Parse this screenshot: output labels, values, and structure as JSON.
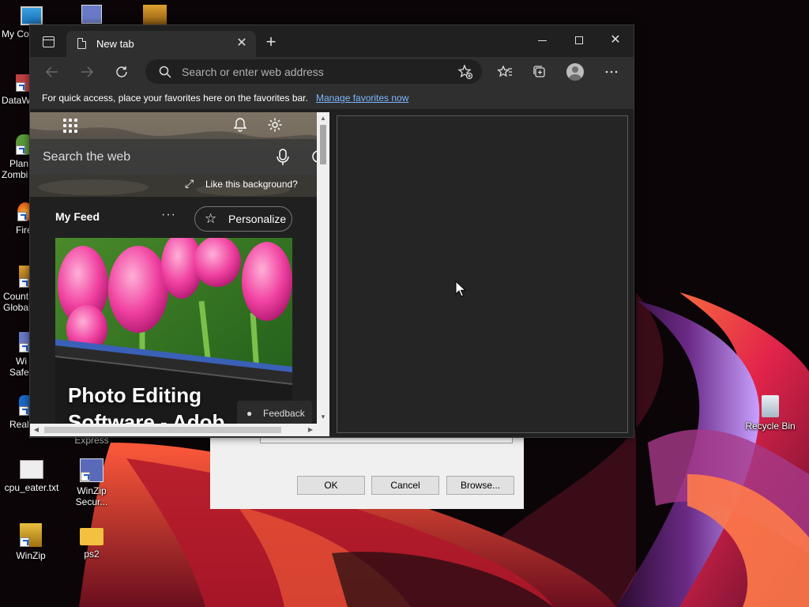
{
  "desktop": {
    "icons": [
      {
        "label": "My Co",
        "name": "my-computer"
      },
      {
        "label": "DataW",
        "name": "dataw"
      },
      {
        "label": "Plan",
        "label2": "Zombi",
        "name": "plants-vs-zombies"
      },
      {
        "label": "Fire",
        "name": "firefox"
      },
      {
        "label": "Count",
        "label2": "Global",
        "name": "counter-strike"
      },
      {
        "label": "Wi",
        "label2": "Safe",
        "name": "winzip-safe"
      },
      {
        "label": "Reall",
        "name": "realplayer"
      },
      {
        "label": "cpu_eater.txt",
        "name": "cpu-eater"
      },
      {
        "label": "WinZip",
        "label2": "Secur...",
        "name": "winzip-secure"
      },
      {
        "label": "WinZip",
        "name": "winzip"
      },
      {
        "label": "ps2",
        "name": "ps2"
      },
      {
        "label": "Express",
        "name": "express"
      },
      {
        "label": "Recycle Bin",
        "name": "recycle-bin"
      }
    ]
  },
  "dialog": {
    "ok_label": "OK",
    "cancel_label": "Cancel",
    "browse_label": "Browse..."
  },
  "browser": {
    "tab": {
      "title": "New tab",
      "close": "✕"
    },
    "new_tab": "+",
    "controls": {
      "close": "✕"
    },
    "address": {
      "placeholder": "Search or enter web address"
    },
    "favorites_bar": {
      "text": "For quick access, place your favorites here on the favorites bar.",
      "link": "Manage favorites now"
    },
    "newtab": {
      "search_placeholder": "Search the web",
      "background_prompt": "Like this background?",
      "feed_title": "My Feed",
      "feed_more": "···",
      "personalize_label": "Personalize",
      "card_title": "Photo Editing Software - Adob",
      "feedback_label": "Feedback"
    }
  },
  "colors": {
    "browser_bg": "#202020",
    "toolbar_bg": "#2f2f2f",
    "link": "#7cb8ff"
  }
}
